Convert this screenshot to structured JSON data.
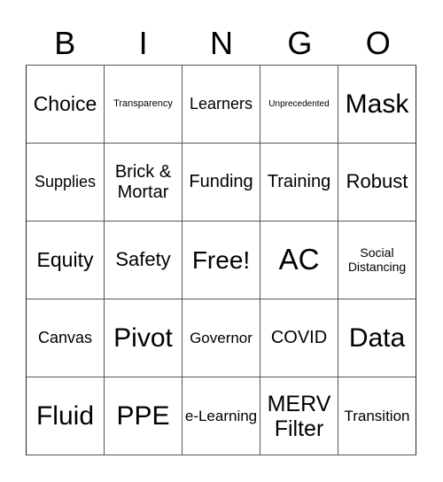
{
  "header": [
    "B",
    "I",
    "N",
    "G",
    "O"
  ],
  "cells": [
    "Choice",
    "Transparency",
    "Learners",
    "Unprecedented",
    "Mask",
    "Supplies",
    "Brick & Mortar",
    "Funding",
    "Training",
    "Robust",
    "Equity",
    "Safety",
    "Free!",
    "AC",
    "Social Distancing",
    "Canvas",
    "Pivot",
    "Governor",
    "COVID",
    "Data",
    "Fluid",
    "PPE",
    "e-Learning",
    "MERV Filter",
    "Transition"
  ]
}
